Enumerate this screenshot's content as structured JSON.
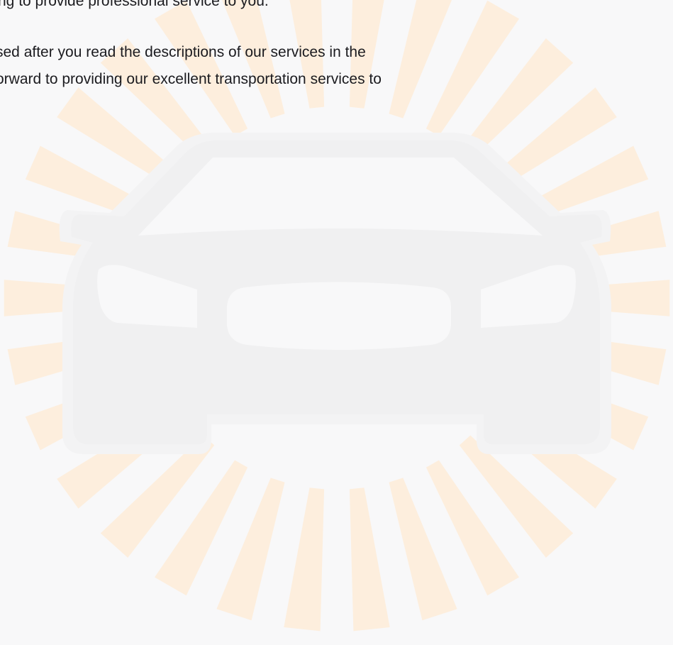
{
  "content": {
    "line1": "ng to provide professional service to you.",
    "line2": "sed after you read the descriptions of our services in the",
    "line3": "orward to providing our excellent transportation services to",
    "line4": "."
  },
  "colors": {
    "background": "#f8f8f9",
    "rays": "#fdeedd",
    "car": "#f0f0f1",
    "car_details": "#f8f8f9",
    "text": "#1b1b1f"
  },
  "icons": {
    "car": "car-front-illustration",
    "rays": "sunburst-rays"
  }
}
